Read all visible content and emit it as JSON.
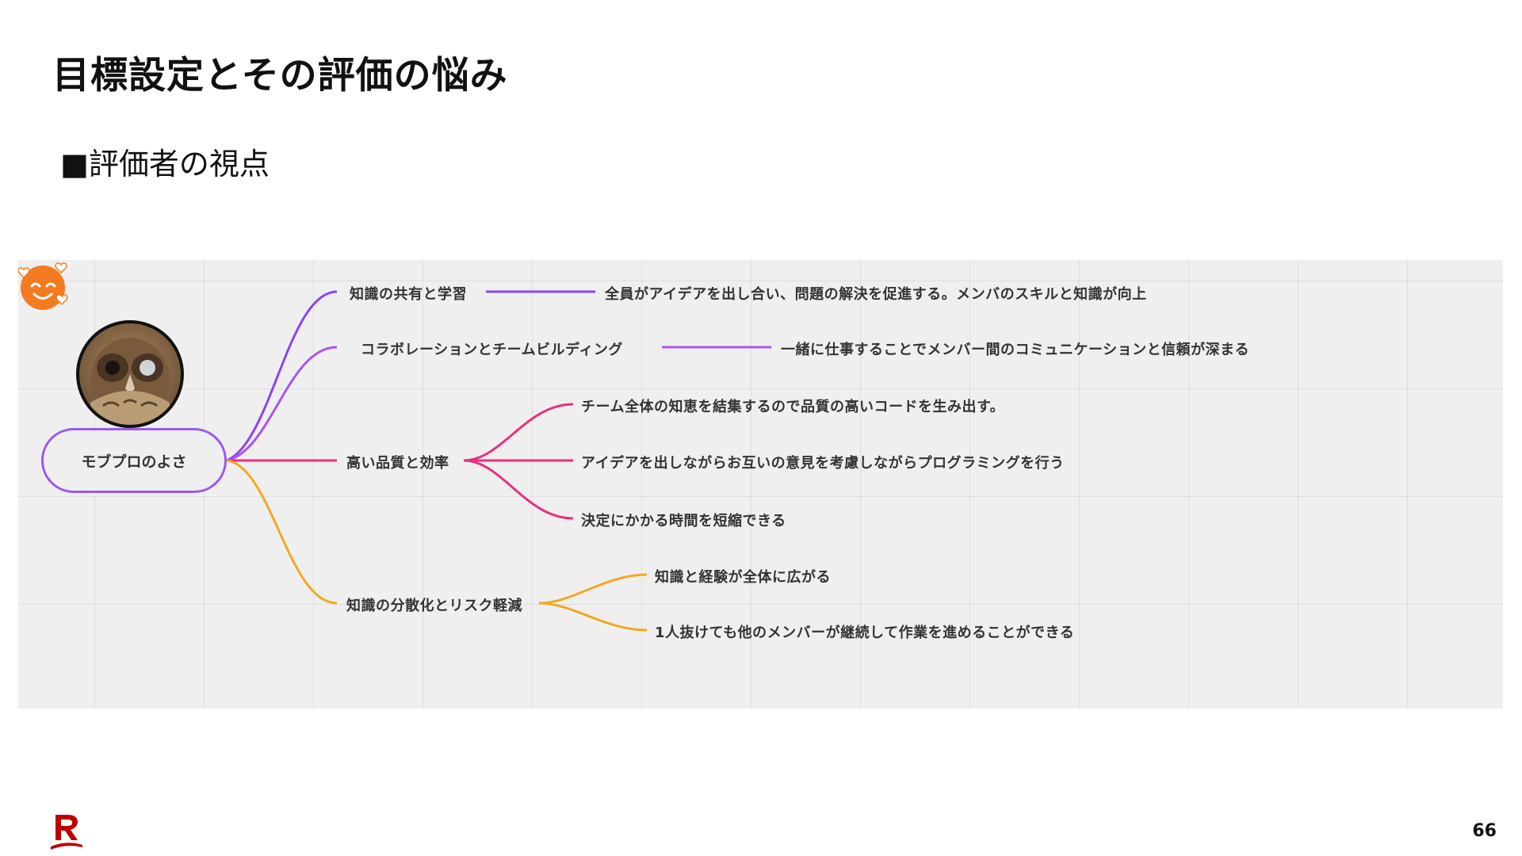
{
  "slide": {
    "title": "目標設定とその評価の悩み",
    "subtitle": "■評価者の視点",
    "page_number": "66"
  },
  "mindmap": {
    "root": "モブプロのよさ",
    "branches": [
      {
        "label": "知識の共有と学習",
        "color": "#8b45ee",
        "children": [
          "全員がアイデアを出し合い、問題の解決を促進する。メンバのスキルと知識が向上"
        ]
      },
      {
        "label": "コラボレーションとチームビルディング",
        "color": "#a955f2",
        "children": [
          "一緒に仕事することでメンバー間のコミュニケーションと信頼が深まる"
        ]
      },
      {
        "label": "高い品質と効率",
        "color": "#e8307f",
        "children": [
          "チーム全体の知恵を結集するので品質の高いコードを生み出す。",
          "アイデアを出しながらお互いの意見を考慮しながらプログラミングを行う",
          "決定にかかる時間を短縮できる"
        ]
      },
      {
        "label": "知識の分散化とリスク軽減",
        "color": "#f2a922",
        "children": [
          "知識と経験が全体に広がる",
          "1人抜けても他のメンバーが継続して作業を進めることができる"
        ]
      }
    ]
  },
  "icons": {
    "avatar": "owl-photo",
    "emoji": "smiling-face-with-hearts-icon",
    "logo": "rakuten-r-logo",
    "emoji_color": "#f47b20",
    "logo_color": "#bf0000"
  }
}
